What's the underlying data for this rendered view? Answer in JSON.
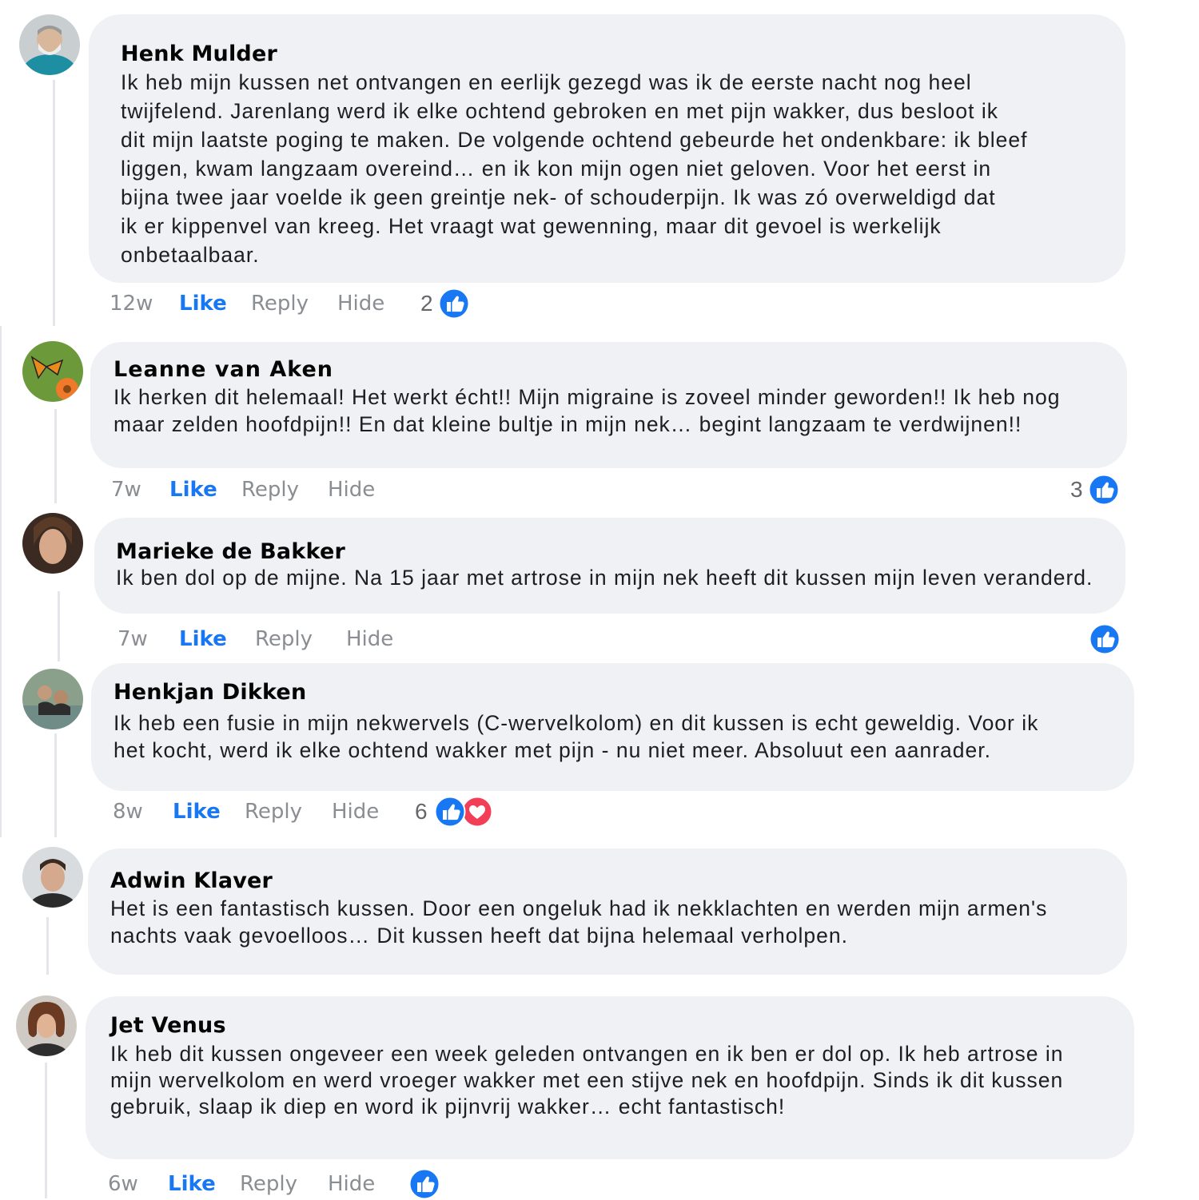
{
  "comments": [
    {
      "author": "Henk Mulder",
      "lines": [
        "Ik heb mijn kussen net ontvangen en eerlijk gezegd was ik de eerste nacht nog heel",
        "twijfelend. Jarenlang werd ik elke ochtend gebroken en met pijn wakker, dus besloot ik",
        "dit mijn laatste poging te maken. De volgende ochtend gebeurde het ondenkbare: ik bleef",
        "liggen, kwam langzaam overeind… en ik kon mijn ogen niet geloven. Voor het eerst in",
        "bijna twee jaar voelde ik geen greintje nek- of schouderpijn. Ik was zó overweldigd dat",
        "ik er kippenvel van kreeg. Het vraagt wat gewenning, maar dit gevoel is werkelijk",
        "onbetaalbaar."
      ],
      "time": "12w",
      "like": "Like",
      "reply": "Reply",
      "hide": "Hide",
      "reaction_count": "2",
      "reactions": [
        "like-icon"
      ]
    },
    {
      "author": "Leanne van Aken",
      "lines": [
        "Ik herken dit helemaal! Het werkt écht!! Mijn migraine is zoveel minder geworden!! Ik heb nog",
        "maar zelden hoofdpijn!! En dat kleine bultje in mijn nek… begint langzaam te verdwijnen!!"
      ],
      "time": "7w",
      "like": "Like",
      "reply": "Reply",
      "hide": "Hide",
      "reaction_count": "3",
      "reactions": [
        "like-icon"
      ]
    },
    {
      "author": "Marieke de Bakker",
      "lines": [
        "Ik ben dol op de mijne. Na 15 jaar met artrose in mijn nek heeft dit kussen mijn leven veranderd."
      ],
      "time": "7w",
      "like": "Like",
      "reply": "Reply",
      "hide": "Hide",
      "reaction_count": "",
      "reactions": [
        "like-icon"
      ]
    },
    {
      "author": "Henkjan Dikken",
      "lines": [
        "Ik heb een fusie in mijn nekwervels (C-wervelkolom) en dit kussen is echt geweldig. Voor ik",
        "het kocht, werd ik elke ochtend wakker met pijn - nu niet meer. Absoluut een aanrader."
      ],
      "time": "8w",
      "like": "Like",
      "reply": "Reply",
      "hide": "Hide",
      "reaction_count": "6",
      "reactions": [
        "like-icon",
        "love-icon"
      ]
    },
    {
      "author": "Adwin Klaver",
      "lines": [
        "Het is een fantastisch kussen. Door een ongeluk had ik nekklachten en werden mijn armen's",
        "nachts vaak gevoelloos… Dit kussen heeft dat bijna helemaal verholpen."
      ]
    },
    {
      "author": "Jet Venus",
      "lines": [
        "Ik heb dit kussen ongeveer een week geleden ontvangen en ik ben er dol op. Ik heb artrose in",
        "mijn wervelkolom en werd vroeger wakker met een stijve nek en hoofdpijn. Sinds ik dit kussen",
        "gebruik, slaap ik diep en word ik pijnvrij wakker… echt fantastisch!"
      ],
      "time": "6w",
      "like": "Like",
      "reply": "Reply",
      "hide": "Hide",
      "reaction_count": "",
      "reactions": [
        "like-icon"
      ]
    }
  ],
  "colors": {
    "like_blue": "#1877f2",
    "love_red": "#f33e58",
    "bubble": "#eff1f4",
    "muted": "#8a8d91"
  }
}
